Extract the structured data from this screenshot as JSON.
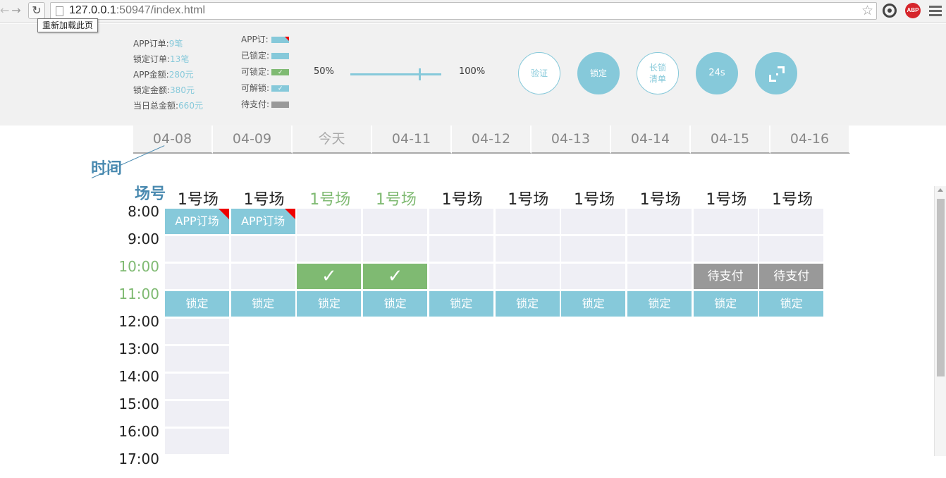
{
  "browser": {
    "url_host": "127.0.0.1",
    "url_rest": ":50947/index.html",
    "tooltip": "重新加载此页",
    "abp_label": "ABP"
  },
  "stats": [
    {
      "label": "APP订单:",
      "value": "9笔"
    },
    {
      "label": "锁定订单:",
      "value": "13笔"
    },
    {
      "label": "APP金额:",
      "value": "280元"
    },
    {
      "label": "锁定金额:",
      "value": "380元"
    },
    {
      "label": "当日总金额:",
      "value": "660元"
    }
  ],
  "legend": [
    {
      "label": "APP订:",
      "swatch": "blue-flag"
    },
    {
      "label": "已锁定:",
      "swatch": "blue"
    },
    {
      "label": "可锁定:",
      "swatch": "green-check"
    },
    {
      "label": "可解锁:",
      "swatch": "blue-check"
    },
    {
      "label": "待支付:",
      "swatch": "gray"
    }
  ],
  "slider": {
    "min_label": "50%",
    "max_label": "100%",
    "value_fraction": 0.76
  },
  "buttons": {
    "verify": "验证",
    "lock": "锁定",
    "long_lock": "长锁清单",
    "timer": "24s",
    "expand_icon": "expand-icon"
  },
  "dates": [
    "04-08",
    "04-09",
    "今天",
    "04-11",
    "04-12",
    "04-13",
    "04-14",
    "04-15",
    "04-16"
  ],
  "corner": {
    "time": "时间",
    "court": "场号"
  },
  "courts": [
    {
      "label": "1号场",
      "highlight": false
    },
    {
      "label": "1号场",
      "highlight": false
    },
    {
      "label": "1号场",
      "highlight": true
    },
    {
      "label": "1号场",
      "highlight": true
    },
    {
      "label": "1号场",
      "highlight": false
    },
    {
      "label": "1号场",
      "highlight": false
    },
    {
      "label": "1号场",
      "highlight": false
    },
    {
      "label": "1号场",
      "highlight": false
    },
    {
      "label": "1号场",
      "highlight": false
    },
    {
      "label": "1号场",
      "highlight": false
    }
  ],
  "times": [
    {
      "label": "8:00",
      "highlight": false
    },
    {
      "label": "9:00",
      "highlight": false
    },
    {
      "label": "10:00",
      "highlight": true
    },
    {
      "label": "11:00",
      "highlight": true
    },
    {
      "label": "12:00",
      "highlight": false
    },
    {
      "label": "13:00",
      "highlight": false
    },
    {
      "label": "14:00",
      "highlight": false
    },
    {
      "label": "15:00",
      "highlight": false
    },
    {
      "label": "16:00",
      "highlight": false
    },
    {
      "label": "17:00",
      "highlight": false
    }
  ],
  "grid": {
    "app_text": "APP订场",
    "check_text": "✓",
    "pay_text": "待支付",
    "lock_text": "锁定",
    "rows": [
      [
        "app",
        "app",
        "empty",
        "empty",
        "empty",
        "empty",
        "empty",
        "empty",
        "empty",
        "empty"
      ],
      [
        "empty",
        "empty",
        "empty",
        "empty",
        "empty",
        "empty",
        "empty",
        "empty",
        "empty",
        "empty"
      ],
      [
        "empty",
        "empty",
        "ok",
        "ok",
        "empty",
        "empty",
        "empty",
        "empty",
        "pay",
        "pay"
      ],
      [
        "lock",
        "lock",
        "lock",
        "lock",
        "lock",
        "lock",
        "lock",
        "lock",
        "lock",
        "lock"
      ],
      [
        "empty"
      ],
      [
        "empty"
      ],
      [
        "empty"
      ],
      [
        "empty"
      ],
      [
        "empty"
      ]
    ]
  },
  "colors": {
    "accent": "#86c9da",
    "available": "#7fba72",
    "pending": "#999999",
    "flag": "#ee0000",
    "header_text": "#4a8ab0"
  }
}
